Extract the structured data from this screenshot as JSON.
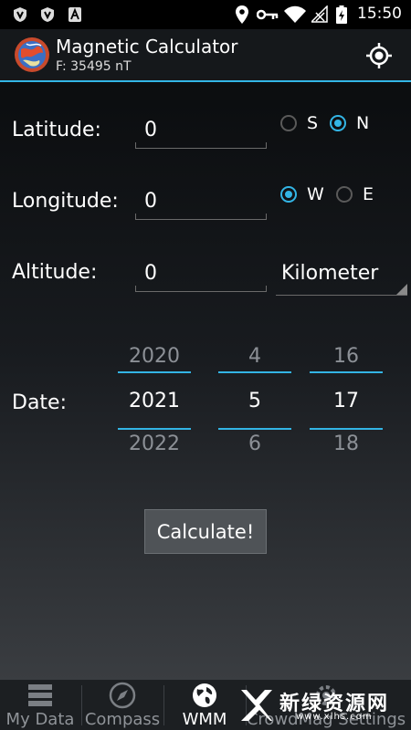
{
  "status_bar": {
    "time": "15:50"
  },
  "action_bar": {
    "title": "Magnetic Calculator",
    "subtitle": "F: 35495 nT"
  },
  "form": {
    "latitude": {
      "label": "Latitude:",
      "value": "0",
      "hemisphere": {
        "options": [
          "S",
          "N"
        ],
        "selected": "N"
      }
    },
    "longitude": {
      "label": "Longitude:",
      "value": "0",
      "hemisphere": {
        "options": [
          "W",
          "E"
        ],
        "selected": "W"
      }
    },
    "altitude": {
      "label": "Altitude:",
      "value": "0",
      "unit": "Kilometer"
    },
    "date": {
      "label": "Date:",
      "year": {
        "prev": "2020",
        "current": "2021",
        "next": "2022"
      },
      "month": {
        "prev": "4",
        "current": "5",
        "next": "6"
      },
      "day": {
        "prev": "16",
        "current": "17",
        "next": "18"
      }
    },
    "calculate_label": "Calculate!"
  },
  "tabs": [
    {
      "label": "My Data",
      "icon": "server-icon"
    },
    {
      "label": "Compass",
      "icon": "compass-icon"
    },
    {
      "label": "WMM",
      "icon": "globe-icon",
      "active": true
    },
    {
      "label": "CrowdMag Settings",
      "icon": "settings-icon"
    }
  ],
  "watermark": {
    "text": "新绿资源网",
    "url": "www.xlhs.com"
  },
  "colors": {
    "accent": "#33b5e5",
    "background": "#0b0c0e",
    "bar": "#15181b"
  }
}
